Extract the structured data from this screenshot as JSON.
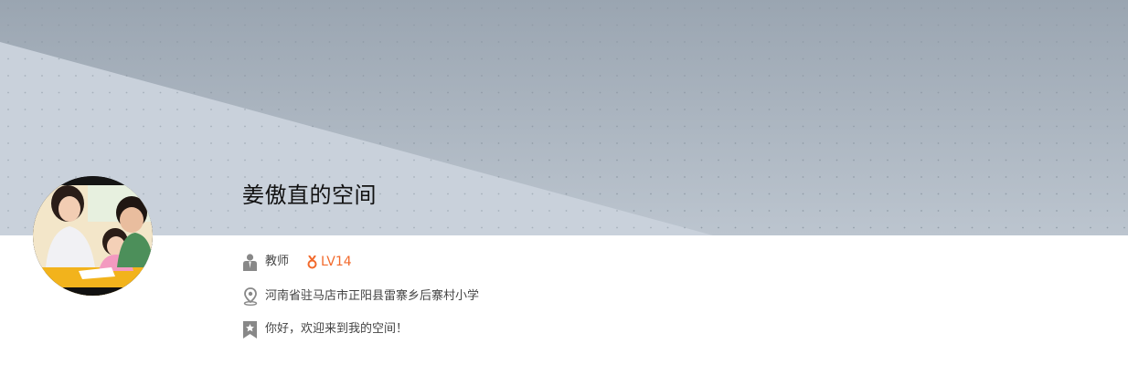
{
  "profile": {
    "space_title": "姜傲直的空间",
    "role": "教师",
    "level": "LV14",
    "location": "河南省驻马店市正阳县雷寨乡后寨村小学",
    "greeting": "你好，欢迎来到我的空间！"
  },
  "icons": {
    "role": "teacher-person-icon",
    "level": "medal-icon",
    "location": "map-pin-icon",
    "greeting": "bookmark-star-icon"
  },
  "colors": {
    "banner_dark": "#9aa7b4",
    "banner_light": "#c8d0d9",
    "level": "#f26a2c",
    "icon_gray": "#888888",
    "text": "#444444"
  }
}
